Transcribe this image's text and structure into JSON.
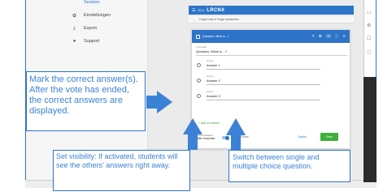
{
  "sidebar": {
    "items": [
      {
        "label": "Session",
        "icon": "session-icon",
        "active": true
      },
      {
        "label": "Einstellungen",
        "icon": "gear-icon",
        "active": false
      },
      {
        "label": "Export",
        "icon": "export-icon",
        "active": false
      },
      {
        "label": "Support",
        "icon": "help-icon",
        "active": false
      }
    ]
  },
  "appbar": {
    "session_id": "8214",
    "title": "LRCNX"
  },
  "breadcrumb": {
    "text": "Frage-Liste & Frage bearbeiten"
  },
  "editor": {
    "header_label": "Question: What is...?",
    "question_small_label": "Fra-Label",
    "question_text": "Question: What is ...?",
    "answers": [
      {
        "small": "Answer",
        "label": "Answer 1"
      },
      {
        "small": "Answer",
        "label": "Answer 2"
      },
      {
        "small": "Answer",
        "label": "Answer 3"
      }
    ],
    "add_answer": "+ Add an answer",
    "visibility_label": "Show answers",
    "visibility_value": "after response",
    "mc_label": "Multiple Choice",
    "cancel": "Cancel",
    "save": "Save"
  },
  "callouts": {
    "correct": "Mark the correct answer(s). After the vote has ended, the correct answers are displayed.",
    "visibility": "Set visibility: If activated, students will see the others' answers right away.",
    "switch": "Switch between single and multiple choice question."
  },
  "colors": {
    "accent": "#2d74c8",
    "callout_text": "#3b83d6",
    "save": "#3bb03b",
    "arrow": "#3b82d6"
  }
}
